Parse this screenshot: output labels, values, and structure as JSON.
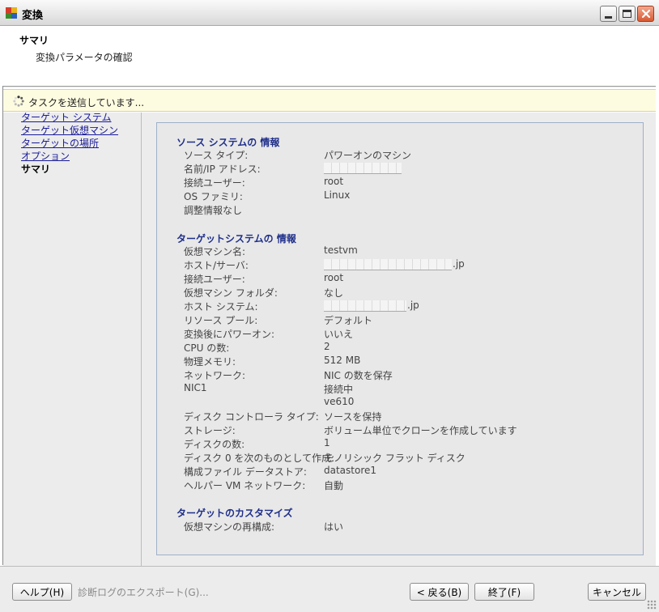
{
  "window": {
    "title": "変換"
  },
  "header": {
    "step_title": "サマリ",
    "step_subtitle": "変換パラメータの確認"
  },
  "notice": {
    "text": "タスクを送信しています..."
  },
  "nav": {
    "items": [
      {
        "label": "ターゲット システム",
        "current": false
      },
      {
        "label": "ターゲット仮想マシン",
        "current": false
      },
      {
        "label": "ターゲットの場所",
        "current": false
      },
      {
        "label": "オプション",
        "current": false
      },
      {
        "label": "サマリ",
        "current": true
      }
    ]
  },
  "summary": {
    "source": {
      "title": "ソース システムの 情報",
      "rows": [
        {
          "label": "ソース タイプ:",
          "value": "パワーオンのマシン"
        },
        {
          "label": "名前/IP アドレス:",
          "value": ""
        },
        {
          "label": "接続ユーザー:",
          "value": "root"
        },
        {
          "label": "OS ファミリ:",
          "value": "Linux"
        },
        {
          "label": "調整情報なし",
          "value": ""
        }
      ]
    },
    "target": {
      "title": "ターゲットシステムの 情報",
      "rows": [
        {
          "label": "仮想マシン名:",
          "value": "testvm"
        },
        {
          "label": "ホスト/サーバ:",
          "value": ".jp"
        },
        {
          "label": "接続ユーザー:",
          "value": "root"
        },
        {
          "label": "仮想マシン フォルダ:",
          "value": "なし"
        },
        {
          "label": "ホスト システム:",
          "value": ".jp"
        },
        {
          "label": "リソース プール:",
          "value": "デフォルト"
        },
        {
          "label": "変換後にパワーオン:",
          "value": "いいえ"
        },
        {
          "label": "CPU の数:",
          "value": "2"
        },
        {
          "label": "物理メモリ:",
          "value": "512 MB"
        },
        {
          "label": "ネットワーク:",
          "value": "NIC の数を保存"
        },
        {
          "label": "NIC1",
          "value": "接続中"
        },
        {
          "label": "",
          "value": "ve610"
        },
        {
          "label": "ディスク コントローラ タイプ:",
          "value": "ソースを保持"
        },
        {
          "label": "ストレージ:",
          "value": "ボリューム単位でクローンを作成しています"
        },
        {
          "label": "ディスクの数:",
          "value": "1"
        },
        {
          "label": "ディスク 0 を次のものとして作成:",
          "value": "モノリシック フラット ディスク"
        },
        {
          "label": "構成ファイル データストア:",
          "value": "datastore1"
        },
        {
          "label": "ヘルパー VM ネットワーク:",
          "value": "自動"
        }
      ]
    },
    "customize": {
      "title": "ターゲットのカスタマイズ",
      "rows": [
        {
          "label": "仮想マシンの再構成:",
          "value": "はい"
        }
      ]
    }
  },
  "footer": {
    "help": "ヘルプ(H)",
    "export_logs": "診断ログのエクスポート(G)...",
    "back": "< 戻る(B)",
    "finish": "終了(F)",
    "cancel": "キャンセル"
  }
}
